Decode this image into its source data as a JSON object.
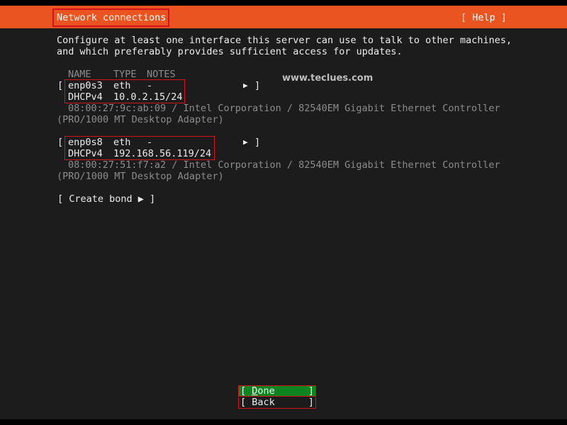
{
  "header": {
    "title": "Network connections",
    "help_label": "[ Help ]"
  },
  "intro": {
    "line1": "Configure at least one interface this server can use to talk to other machines,",
    "line2": "and which preferably provides sufficient access for updates."
  },
  "columns": {
    "name": "NAME",
    "type": "TYPE",
    "notes": "NOTES"
  },
  "interfaces": [
    {
      "name": "enp0s3",
      "type": "eth",
      "notes": "-",
      "method": "DHCPv4",
      "address": "10.0.2.15/24",
      "desc_line1": "08:00:27:9c:ab:09 / Intel Corporation / 82540EM Gigabit Ethernet Controller",
      "desc_line2": "(PRO/1000 MT Desktop Adapter)"
    },
    {
      "name": "enp0s8",
      "type": "eth",
      "notes": "-",
      "method": "DHCPv4",
      "address": "192.168.56.119/24",
      "desc_line1": "08:00:27:51:f7:a2 / Intel Corporation / 82540EM Gigabit Ethernet Controller",
      "desc_line2": "(PRO/1000 MT Desktop Adapter)"
    }
  ],
  "glyphs": {
    "open_bracket": "[",
    "close_bracket": "]",
    "arrow": "▶"
  },
  "create_bond_label": "[ Create bond ▶ ]",
  "watermark": "www.teclues.com",
  "footer": {
    "done_first": "D",
    "done_rest": "one",
    "back_label": "Back"
  },
  "colors": {
    "header_bg": "#e95420",
    "body_bg": "#1c1c1c",
    "highlight_border": "#d4141c",
    "done_bg": "#0e8420",
    "dim_text": "#8c8c8c"
  }
}
